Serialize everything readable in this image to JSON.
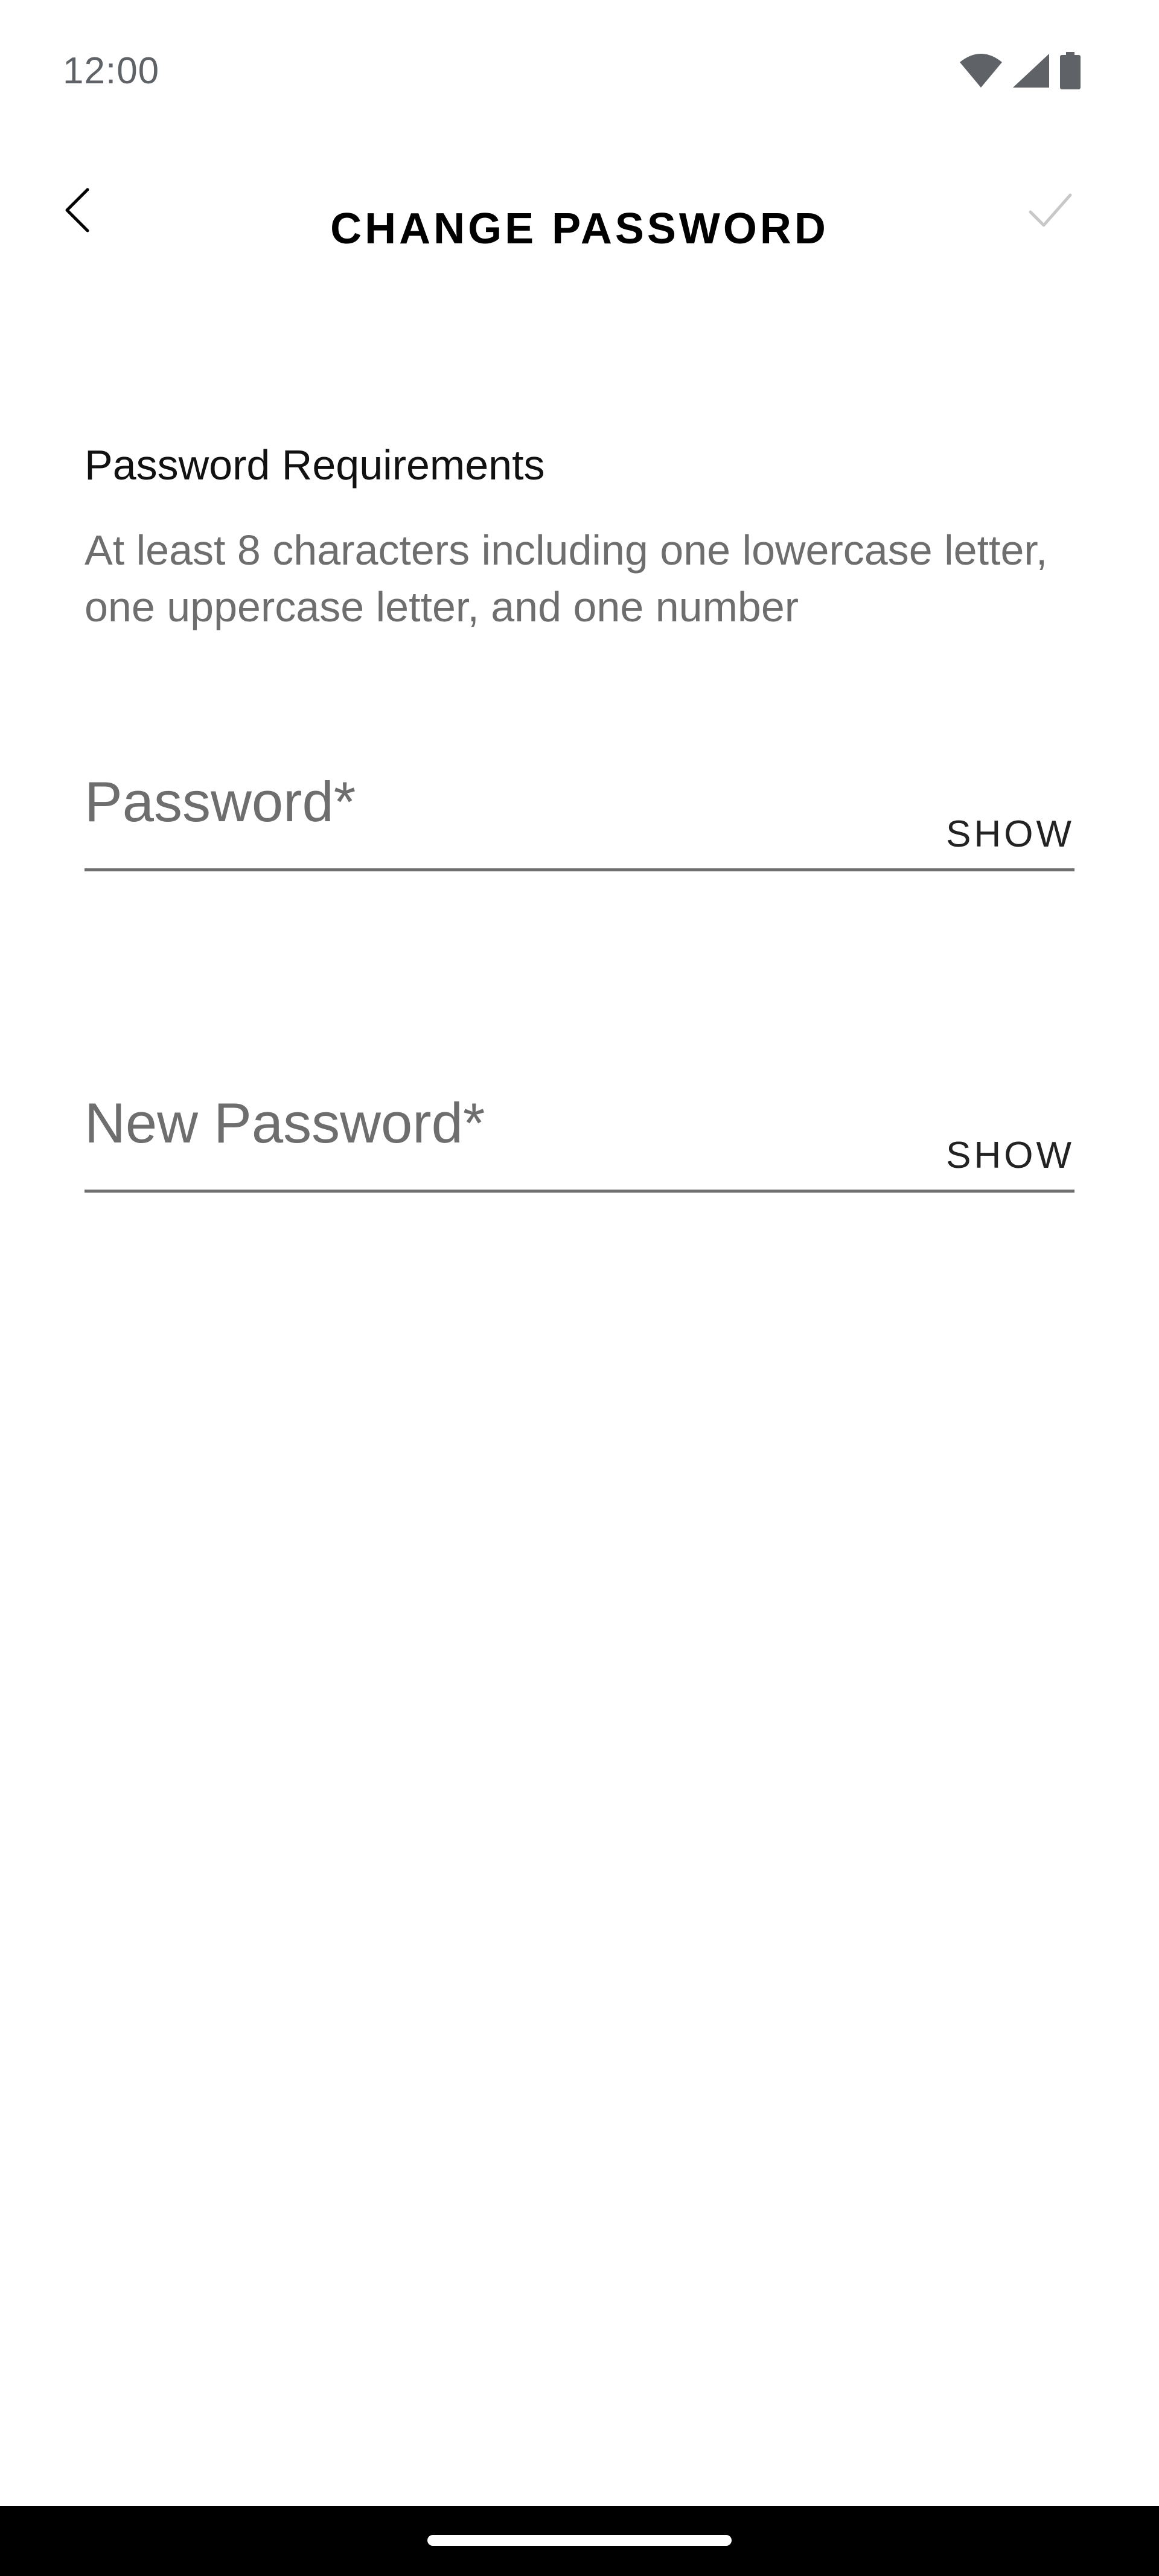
{
  "status_bar": {
    "time": "12:00",
    "icons": [
      "wifi-icon",
      "signal-icon",
      "battery-icon"
    ]
  },
  "header": {
    "title": "CHANGE PASSWORD",
    "back_icon": "chevron-left-icon",
    "confirm_icon": "check-icon"
  },
  "requirements": {
    "title": "Password Requirements",
    "description": "At least 8 characters including one lowercase letter, one uppercase letter, and one number"
  },
  "fields": {
    "password": {
      "placeholder": "Password*",
      "value": "",
      "toggle_label": "SHOW"
    },
    "new_password": {
      "placeholder": "New Password*",
      "value": "",
      "toggle_label": "SHOW"
    }
  },
  "colors": {
    "background": "#ffffff",
    "text_primary": "#000000",
    "text_secondary": "#6e6e6e",
    "confirm_disabled": "#c8c8c8",
    "nav_bar": "#000000"
  }
}
